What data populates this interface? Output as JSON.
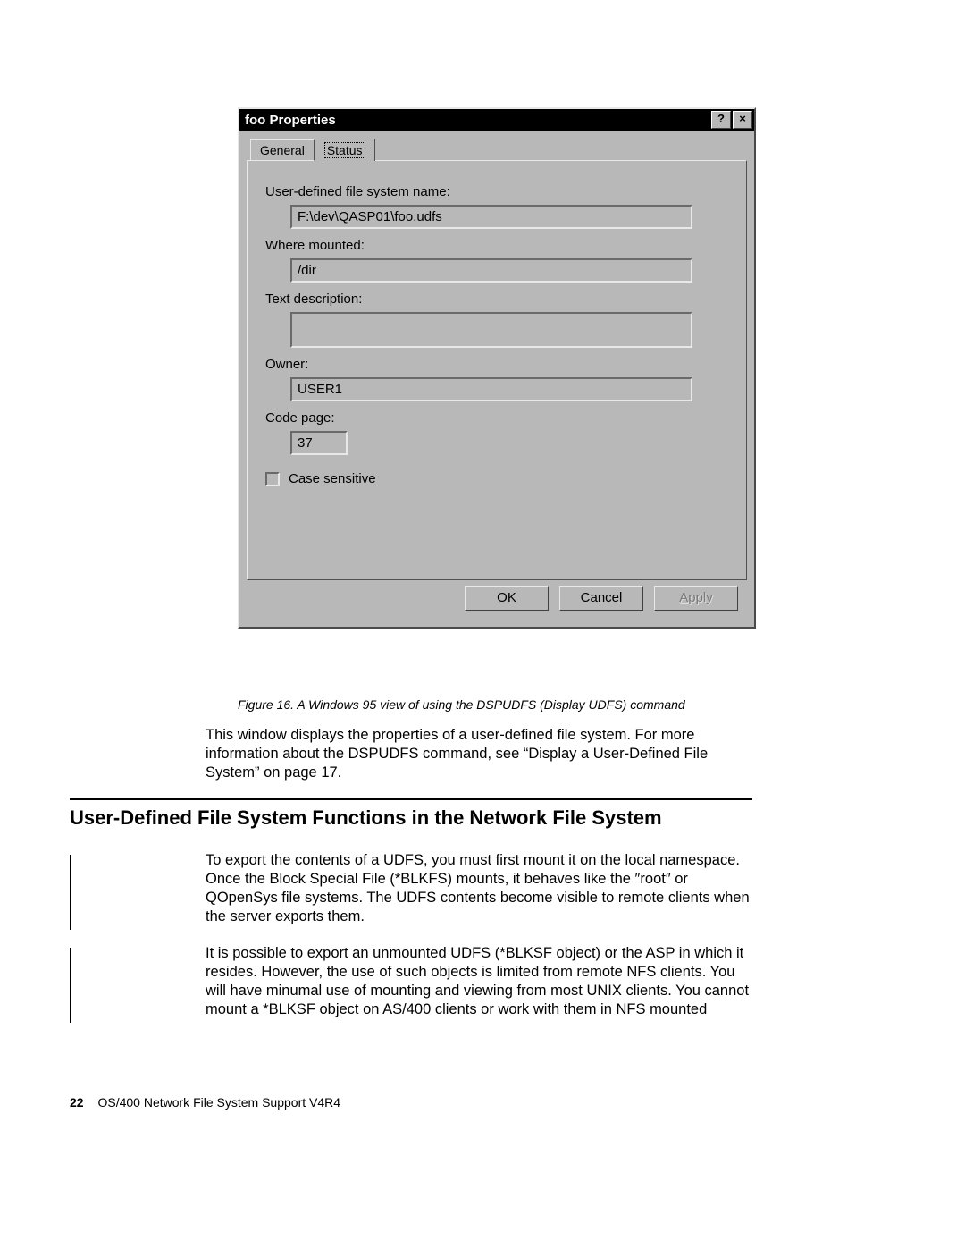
{
  "dialog": {
    "title": "foo Properties",
    "tabs": {
      "general": "General",
      "status": "Status"
    },
    "labels": {
      "udfs_name": "User-defined file system name:",
      "where_mounted": "Where mounted:",
      "text_desc": "Text description:",
      "owner": "Owner:",
      "code_page": "Code page:",
      "case_sensitive": "Case sensitive"
    },
    "values": {
      "udfs_name": "F:\\dev\\QASP01\\foo.udfs",
      "where_mounted": "/dir",
      "text_desc": "",
      "owner": "USER1",
      "code_page": "37"
    },
    "buttons": {
      "ok": "OK",
      "cancel": "Cancel",
      "apply": "Apply"
    }
  },
  "caption": "Figure 16. A Windows 95 view of using the DSPUDFS (Display UDFS) command",
  "body1": "This window displays the properties of a user-defined file system. For more information about the DSPUDFS command, see “Display a User-Defined File System” on page 17.",
  "heading": "User-Defined File System Functions in the Network File System",
  "body2": "To export the contents of a UDFS, you must first mount it on the local namespace. Once the Block Special File (*BLKFS) mounts, it behaves like the ″root″ or QOpenSys file systems. The UDFS contents become visible to remote clients when the server exports them.",
  "body3": "It is possible to export an unmounted UDFS (*BLKSF object) or the ASP in which it resides. However, the use of such objects is limited from remote NFS clients. You will have minumal use of mounting and viewing from most UNIX clients. You cannot mount a *BLKSF object on AS/400 clients or work with them in NFS mounted",
  "footer": {
    "page": "22",
    "title": "OS/400 Network File System Support V4R4"
  }
}
